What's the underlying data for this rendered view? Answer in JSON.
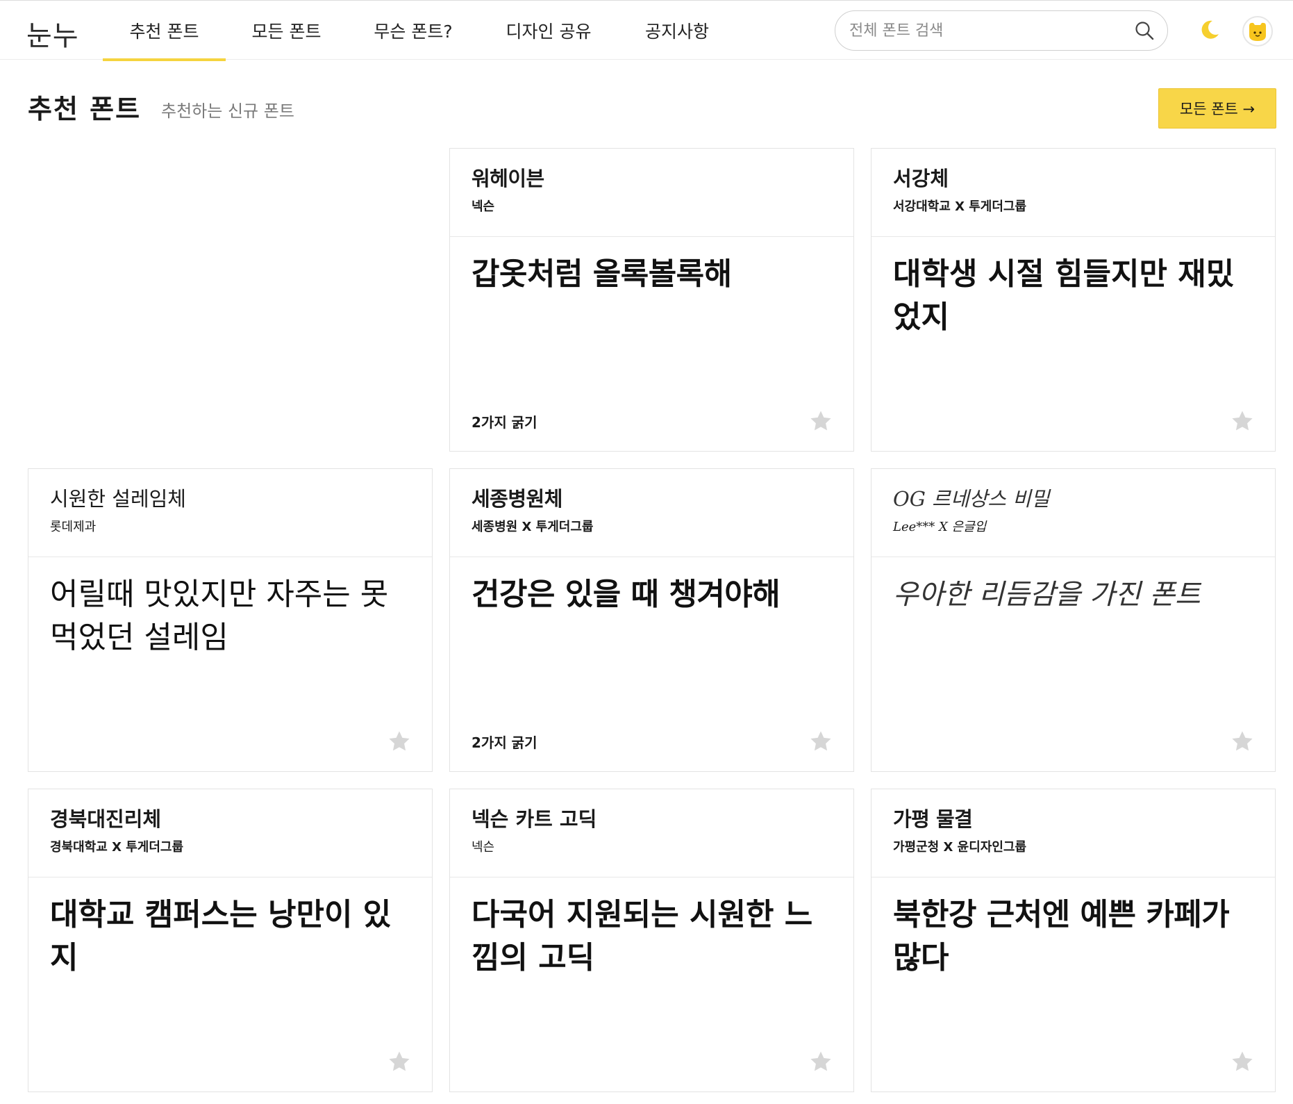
{
  "nav": {
    "logo": "눈누",
    "tabs": [
      {
        "label": "추천 폰트",
        "active": true
      },
      {
        "label": "모든 폰트",
        "active": false
      },
      {
        "label": "무슨 폰트?",
        "active": false
      },
      {
        "label": "디자인 공유",
        "active": false
      },
      {
        "label": "공지사항",
        "active": false
      }
    ],
    "search_placeholder": "전체 폰트 검색",
    "icons": {
      "search": "search-icon",
      "theme": "moon-icon",
      "avatar": "avatar-face-icon"
    },
    "accent_color": "#f5d43f",
    "moon_color": "#f6cf2e"
  },
  "section": {
    "title": "추천 폰트",
    "subtitle": "추천하는 신규 폰트",
    "all_fonts_button": "모든 폰트 →",
    "button_color": "#f8d648"
  },
  "cards": [
    {
      "name": "워헤이븐",
      "maker": "넥슨",
      "sample": "갑옷처럼 올록볼록해",
      "weights": "2가지 굵기"
    },
    {
      "name": "서강체",
      "maker": "서강대학교 X 투게더그룹",
      "sample": "대학생 시절 힘들지만 재밌었지",
      "weights": ""
    },
    {
      "name": "시원한 설레임체",
      "maker": "롯데제과",
      "sample": "어릴때 맛있지만 자주는 못먹었던 설레임",
      "weights": ""
    },
    {
      "name": "세종병원체",
      "maker": "세종병원 X 투게더그룹",
      "sample": "건강은 있을 때 챙겨야해",
      "weights": "2가지 굵기"
    },
    {
      "name": "OG 르네상스 비밀",
      "maker": "Lee*** X 은글입",
      "sample": "우아한 리듬감을 가진 폰트",
      "weights": ""
    },
    {
      "name": "경북대진리체",
      "maker": "경북대학교 X 투게더그룹",
      "sample": "대학교 캠퍼스는 낭만이 있지",
      "weights": ""
    },
    {
      "name": "넥슨 카트 고딕",
      "maker": "넥슨",
      "sample": "다국어 지원되는 시원한 느낌의 고딕",
      "weights": ""
    },
    {
      "name": "가평 물결",
      "maker": "가평군청 X 윤디자인그룹",
      "sample": "북한강 근처엔 예쁜 카페가 많다",
      "weights": ""
    }
  ],
  "star_color": "#d6d6d6"
}
